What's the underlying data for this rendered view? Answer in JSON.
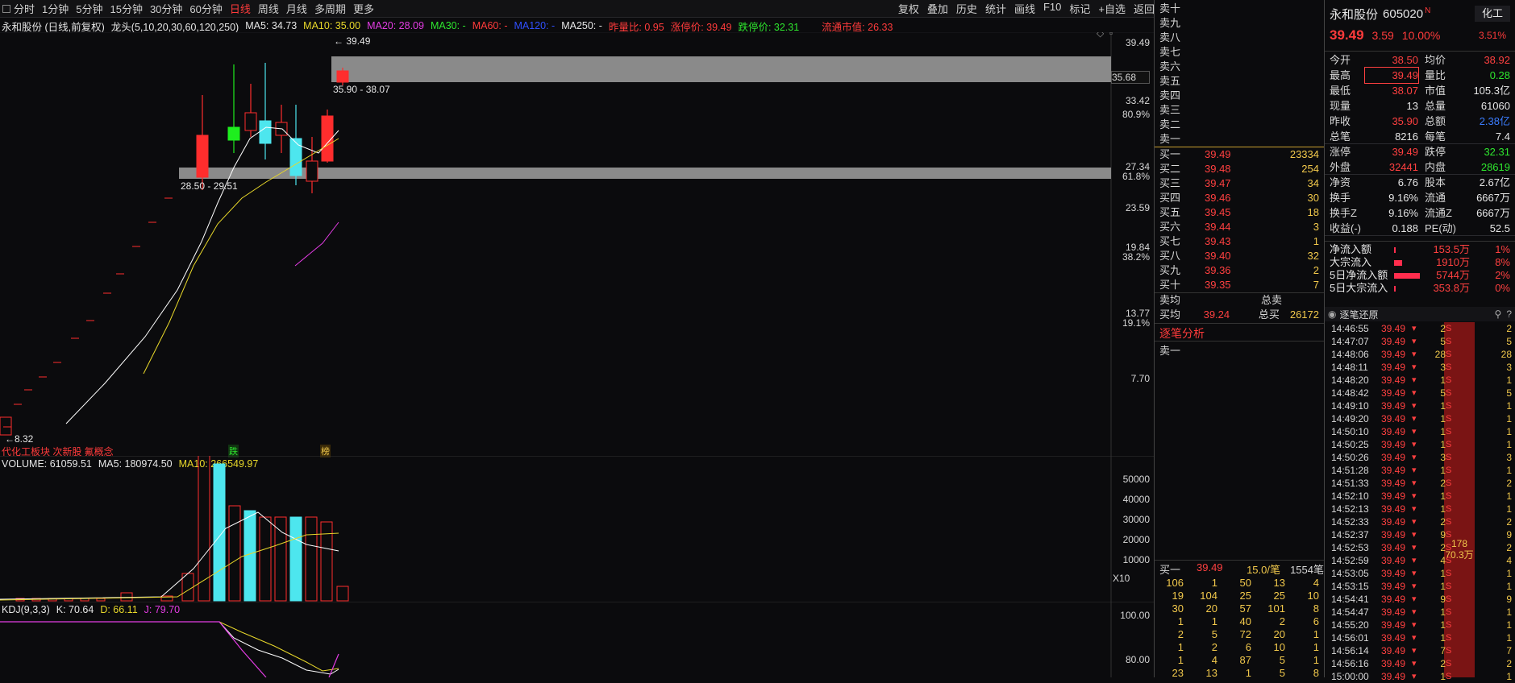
{
  "toolbar": {
    "periods": [
      "分时",
      "1分钟",
      "5分钟",
      "15分钟",
      "30分钟",
      "60分钟",
      "日线",
      "周线",
      "月线",
      "多周期",
      "更多"
    ],
    "active_period": "日线",
    "right_buttons": [
      "复权",
      "叠加",
      "历史",
      "统计",
      "画线",
      "F10",
      "标记",
      "+自选",
      "返回"
    ]
  },
  "main_info": {
    "stock_desc": "永和股份 (日线,前复权)",
    "indicator": "龙头(5,10,20,30,60,120,250)",
    "ma5": "MA5: 34.73",
    "ma10": "MA10: 35.00",
    "ma20": "MA20: 28.09",
    "ma30": "MA30: -",
    "ma60": "MA60: -",
    "ma120": "MA120: -",
    "ma250": "MA250: -",
    "vol_ratio": "昨量比: 0.95",
    "limit_up": "涨停价: 39.49",
    "limit_down": "跌停价: 32.31",
    "float_cap": "流通市值: 26.33"
  },
  "price_axis": [
    "39.49",
    "35.68",
    "33.42",
    "80.9%",
    "27.34",
    "61.8%",
    "23.59",
    "19.84",
    "38.2%",
    "13.77",
    "19.1%",
    "7.70"
  ],
  "annotations": {
    "top_price": "39.49",
    "upper_band": "35.90 - 38.07",
    "lower_band": "28.50 - 29.51",
    "low_price": "8.32",
    "concepts": "代化工板块 次新股 氟概念",
    "mark1": "跌",
    "mark2": "榜"
  },
  "volume_info": {
    "title": "VOLUME: 61059.51",
    "ma5": "MA5: 180974.50",
    "ma10": "MA10: 266549.97",
    "axis": [
      "50000",
      "40000",
      "30000",
      "20000",
      "10000",
      "X10"
    ]
  },
  "kdj_info": {
    "title": "KDJ(9,3,3)",
    "k": "K: 70.64",
    "d": "D: 66.11",
    "j": "J: 79.70",
    "axis": [
      "100.00",
      "80.00"
    ]
  },
  "order_book": {
    "sells": [
      {
        "label": "卖十",
        "price": "",
        "vol": ""
      },
      {
        "label": "卖九",
        "price": "",
        "vol": ""
      },
      {
        "label": "卖八",
        "price": "",
        "vol": ""
      },
      {
        "label": "卖七",
        "price": "",
        "vol": ""
      },
      {
        "label": "卖六",
        "price": "",
        "vol": ""
      },
      {
        "label": "卖五",
        "price": "",
        "vol": ""
      },
      {
        "label": "卖四",
        "price": "",
        "vol": ""
      },
      {
        "label": "卖三",
        "price": "",
        "vol": ""
      },
      {
        "label": "卖二",
        "price": "",
        "vol": ""
      },
      {
        "label": "卖一",
        "price": "",
        "vol": ""
      }
    ],
    "buys": [
      {
        "label": "买一",
        "price": "39.49",
        "vol": "23334"
      },
      {
        "label": "买二",
        "price": "39.48",
        "vol": "254"
      },
      {
        "label": "买三",
        "price": "39.47",
        "vol": "34"
      },
      {
        "label": "买四",
        "price": "39.46",
        "vol": "30"
      },
      {
        "label": "买五",
        "price": "39.45",
        "vol": "18"
      },
      {
        "label": "买六",
        "price": "39.44",
        "vol": "3"
      },
      {
        "label": "买七",
        "price": "39.43",
        "vol": "1"
      },
      {
        "label": "买八",
        "price": "39.40",
        "vol": "32"
      },
      {
        "label": "买九",
        "price": "39.36",
        "vol": "2"
      },
      {
        "label": "买十",
        "price": "39.35",
        "vol": "7"
      }
    ],
    "sell_avg_label": "卖均",
    "total_sell_label": "总卖",
    "buy_avg_label": "买均",
    "buy_avg": "39.24",
    "total_buy_label": "总买",
    "total_buy": "26172",
    "analysis_title": "逐笔分析",
    "analysis_sell1": "卖一",
    "queue_label": "买一",
    "queue_price": "39.49",
    "queue_avg": "15.0/笔",
    "queue_total": "1554笔",
    "ladder": [
      [
        "106",
        "1",
        "50",
        "13",
        "4"
      ],
      [
        "19",
        "104",
        "25",
        "25",
        "10"
      ],
      [
        "30",
        "20",
        "57",
        "101",
        "8"
      ],
      [
        "1",
        "1",
        "40",
        "2",
        "6"
      ],
      [
        "2",
        "5",
        "72",
        "20",
        "1"
      ],
      [
        "1",
        "2",
        "6",
        "10",
        "1"
      ],
      [
        "1",
        "4",
        "87",
        "5",
        "1"
      ],
      [
        "23",
        "13",
        "1",
        "5",
        "8"
      ]
    ]
  },
  "quote": {
    "name": "永和股份",
    "code": "605020",
    "tag": "N",
    "sector": "化工",
    "sector_pct": "3.51%",
    "price": "39.49",
    "change": "3.59",
    "pct": "10.00%",
    "stats": [
      {
        "k": "今开",
        "v": "38.50",
        "k2": "均价",
        "v2": "38.92"
      },
      {
        "k": "最高",
        "v": "39.49",
        "k2": "量比",
        "v2": "0.28"
      },
      {
        "k": "最低",
        "v": "38.07",
        "k2": "市值",
        "v2": "105.3亿"
      },
      {
        "k": "现量",
        "v": "13",
        "k2": "总量",
        "v2": "61060"
      },
      {
        "k": "昨收",
        "v": "35.90",
        "k2": "总额",
        "v2": "2.38亿"
      },
      {
        "k": "总笔",
        "v": "8216",
        "k2": "每笔",
        "v2": "7.4"
      },
      {
        "k": "涨停",
        "v": "39.49",
        "k2": "跌停",
        "v2": "32.31"
      },
      {
        "k": "外盘",
        "v": "32441",
        "k2": "内盘",
        "v2": "28619"
      },
      {
        "k": "净资",
        "v": "6.76",
        "k2": "股本",
        "v2": "2.67亿"
      },
      {
        "k": "换手",
        "v": "9.16%",
        "k2": "流通",
        "v2": "6667万"
      },
      {
        "k": "换手Z",
        "v": "9.16%",
        "k2": "流通Z",
        "v2": "6667万"
      },
      {
        "k": "收益(-)",
        "v": "0.188",
        "k2": "PE(动)",
        "v2": "52.5"
      }
    ],
    "flows": [
      {
        "k": "净流入额",
        "v": "153.5万",
        "p": "1%",
        "bar": 0.05
      },
      {
        "k": "大宗流入",
        "v": "1910万",
        "p": "8%",
        "bar": 0.3
      },
      {
        "k": "5日净流入额",
        "v": "5744万",
        "p": "2%",
        "bar": 1
      },
      {
        "k": "5日大宗流入",
        "v": "353.8万",
        "p": "0%",
        "bar": 0.05
      }
    ]
  },
  "ticks": {
    "title": "逐笔还原",
    "bar_top": "178",
    "bar_bottom": "70.3万",
    "rows": [
      [
        "14:46:55",
        "39.49",
        "2",
        "2"
      ],
      [
        "14:47:07",
        "39.49",
        "5",
        "5"
      ],
      [
        "14:48:06",
        "39.49",
        "28",
        "28"
      ],
      [
        "14:48:11",
        "39.49",
        "3",
        "3"
      ],
      [
        "14:48:20",
        "39.49",
        "1",
        "1"
      ],
      [
        "14:48:42",
        "39.49",
        "5",
        "5"
      ],
      [
        "14:49:10",
        "39.49",
        "1",
        "1"
      ],
      [
        "14:49:20",
        "39.49",
        "1",
        "1"
      ],
      [
        "14:50:10",
        "39.49",
        "1",
        "1"
      ],
      [
        "14:50:25",
        "39.49",
        "1",
        "1"
      ],
      [
        "14:50:26",
        "39.49",
        "3",
        "3"
      ],
      [
        "14:51:28",
        "39.49",
        "1",
        "1"
      ],
      [
        "14:51:33",
        "39.49",
        "2",
        "2"
      ],
      [
        "14:52:10",
        "39.49",
        "1",
        "1"
      ],
      [
        "14:52:13",
        "39.49",
        "1",
        "1"
      ],
      [
        "14:52:33",
        "39.49",
        "2",
        "2"
      ],
      [
        "14:52:37",
        "39.49",
        "9",
        "9"
      ],
      [
        "14:52:53",
        "39.49",
        "2",
        "2"
      ],
      [
        "14:52:59",
        "39.49",
        "4",
        "4"
      ],
      [
        "14:53:05",
        "39.49",
        "1",
        "1"
      ],
      [
        "14:53:15",
        "39.49",
        "1",
        "1"
      ],
      [
        "14:54:41",
        "39.49",
        "9",
        "9"
      ],
      [
        "14:54:47",
        "39.49",
        "1",
        "1"
      ],
      [
        "14:55:20",
        "39.49",
        "1",
        "1"
      ],
      [
        "14:56:01",
        "39.49",
        "1",
        "1"
      ],
      [
        "14:56:14",
        "39.49",
        "7",
        "7"
      ],
      [
        "14:56:16",
        "39.49",
        "2",
        "2"
      ],
      [
        "15:00:00",
        "39.49",
        "1",
        "1"
      ]
    ]
  },
  "colors": {
    "up": "#ff2d2d",
    "down": "#4de6ee",
    "ma5": "#ffffff",
    "ma10": "#e8d82a",
    "ma20": "#e33ce3",
    "bg": "#0b0b0d"
  }
}
